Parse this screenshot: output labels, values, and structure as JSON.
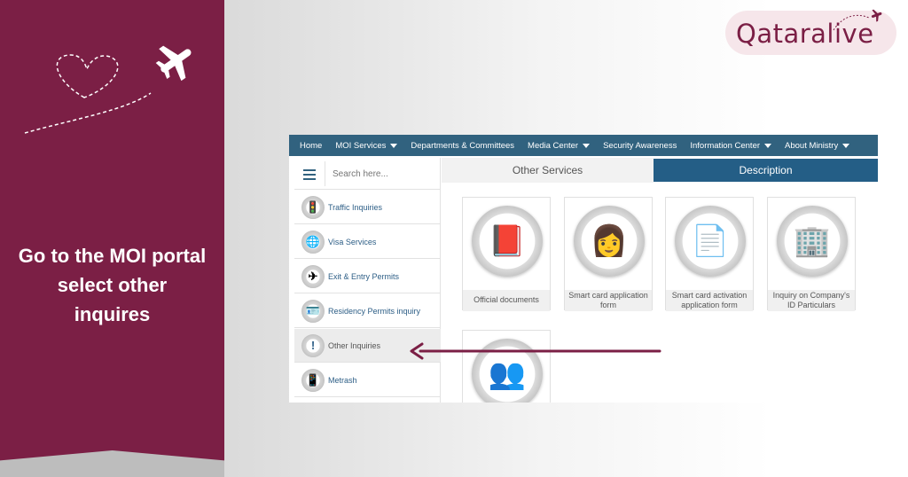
{
  "banner": {
    "caption": "Go to the MOI portal select other inquires",
    "color": "#7b1f45"
  },
  "logo": {
    "text": "Qataralive"
  },
  "nav": {
    "items": [
      {
        "label": "Home",
        "dropdown": false
      },
      {
        "label": "MOI Services",
        "dropdown": true
      },
      {
        "label": "Departments & Committees",
        "dropdown": false
      },
      {
        "label": "Media Center",
        "dropdown": true
      },
      {
        "label": "Security Awareness",
        "dropdown": false
      },
      {
        "label": "Information Center",
        "dropdown": true
      },
      {
        "label": "About Ministry",
        "dropdown": true
      }
    ],
    "color": "#31627f"
  },
  "search": {
    "placeholder": "Search here..."
  },
  "sidebar": {
    "items": [
      {
        "label": "Traffic Inquiries",
        "icon": "traffic-light-icon",
        "glyph": "🚦"
      },
      {
        "label": "Visa Services",
        "icon": "globe-icon",
        "glyph": "🌐"
      },
      {
        "label": "Exit & Entry Permits",
        "icon": "airplane-icon",
        "glyph": "✈"
      },
      {
        "label": "Residency Permits inquiry",
        "icon": "card-icon",
        "glyph": "🪪"
      },
      {
        "label": "Other Inquiries",
        "icon": "exclamation-icon",
        "glyph": "!"
      },
      {
        "label": "Metrash",
        "icon": "phone-icon",
        "glyph": "📱"
      }
    ],
    "active_index": 4
  },
  "tabs": {
    "other_services": "Other Services",
    "description": "Description"
  },
  "cards": [
    {
      "label": "Official documents",
      "icon": "passport-icon",
      "glyph": "📕"
    },
    {
      "label": "Smart card application form",
      "icon": "person-card-icon",
      "glyph": "👩"
    },
    {
      "label": "Smart card activation application form",
      "icon": "document-icon",
      "glyph": "📄"
    },
    {
      "label": "Inquiry on Company's ID Particulars",
      "icon": "building-icon",
      "glyph": "🏢"
    },
    {
      "label": "",
      "icon": "user-exchange-icon",
      "glyph": "👥"
    }
  ],
  "accent": "#7b1f45"
}
